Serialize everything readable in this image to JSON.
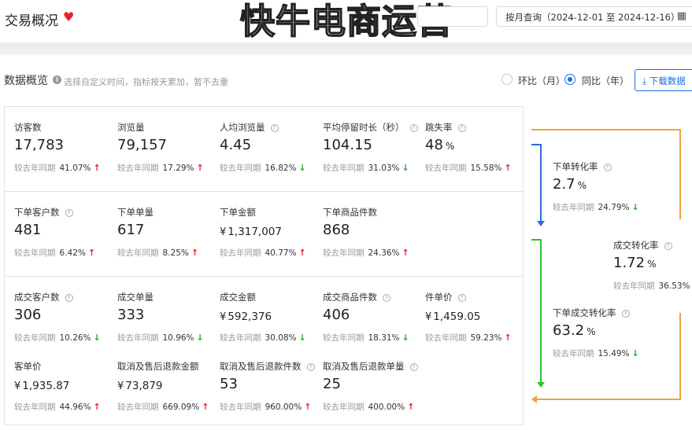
{
  "header": {
    "title": "交易概况",
    "heart_icon": "heart-icon",
    "watermark": "快牛电商运营",
    "date_range": "按月查询（2024-12-01 至 2024-12-16）",
    "calendar_icon": "calendar-icon"
  },
  "overview": {
    "title": "数据概览",
    "hint": "选择自定义时间，指标按天累加，暂不去重",
    "compare_options": [
      {
        "label": "环比（月）",
        "selected": false
      },
      {
        "label": "同比（年）",
        "selected": true
      }
    ],
    "download_label": "下载数据",
    "compare_prefix": "较去年同期"
  },
  "metrics": [
    {
      "label": "访客数",
      "value": "17,783",
      "change": "41.07%",
      "dir": "up",
      "help": false
    },
    {
      "label": "浏览量",
      "value": "79,157",
      "change": "17.29%",
      "dir": "up",
      "help": false
    },
    {
      "label": "人均浏览量",
      "value": "4.45",
      "change": "16.82%",
      "dir": "down",
      "help": true
    },
    {
      "label": "平均停留时长（秒）",
      "value": "104.15",
      "change": "31.03%",
      "dir": "down",
      "help": true
    },
    {
      "label": "跳失率",
      "value": "48",
      "unit": "%",
      "change": "15.58%",
      "dir": "up",
      "help": true
    },
    {
      "label": "下单客户数",
      "value": "481",
      "change": "6.42%",
      "dir": "up",
      "help": true
    },
    {
      "label": "下单单量",
      "value": "617",
      "change": "8.25%",
      "dir": "up",
      "help": false
    },
    {
      "label": "下单金额",
      "value": "1,317,007",
      "currency": "¥",
      "change": "40.77%",
      "dir": "up",
      "help": false
    },
    {
      "label": "下单商品件数",
      "value": "868",
      "change": "24.36%",
      "dir": "up",
      "help": false
    },
    {
      "label": "成交客户数",
      "value": "306",
      "change": "10.26%",
      "dir": "down",
      "help": true
    },
    {
      "label": "成交单量",
      "value": "333",
      "change": "10.96%",
      "dir": "down",
      "help": false
    },
    {
      "label": "成交金额",
      "value": "592,376",
      "currency": "¥",
      "change": "30.08%",
      "dir": "down",
      "help": false
    },
    {
      "label": "成交商品件数",
      "value": "406",
      "change": "18.31%",
      "dir": "down",
      "help": true
    },
    {
      "label": "件单价",
      "value": "1,459.05",
      "currency": "¥",
      "change": "59.23%",
      "dir": "up",
      "help": true
    },
    {
      "label": "客单价",
      "value": "1,935.87",
      "currency": "¥",
      "change": "44.96%",
      "dir": "up",
      "help": false
    },
    {
      "label": "取消及售后退款金额",
      "value": "73,879",
      "currency": "¥",
      "change": "669.09%",
      "dir": "up",
      "help": false
    },
    {
      "label": "取消及售后退款件数",
      "value": "53",
      "change": "960.00%",
      "dir": "up",
      "help": true
    },
    {
      "label": "取消及售后退款单量",
      "value": "25",
      "change": "400.00%",
      "dir": "up",
      "help": true
    }
  ],
  "flow": [
    {
      "label": "下单转化率",
      "value": "2.7",
      "unit": "%",
      "change": "24.79%",
      "dir": "down"
    },
    {
      "label": "成交转化率",
      "value": "1.72",
      "unit": "%",
      "change": "36.53%",
      "dir": "none"
    },
    {
      "label": "下单成交转化率",
      "value": "63.2",
      "unit": "%",
      "change": "15.49%",
      "dir": "down"
    }
  ],
  "colors": {
    "accent": "#1a6ee0",
    "up": "#e8202a",
    "down": "#2aa52a",
    "orange": "#f0a040",
    "blue": "#2c6fd6",
    "green": "#2ec22e"
  }
}
